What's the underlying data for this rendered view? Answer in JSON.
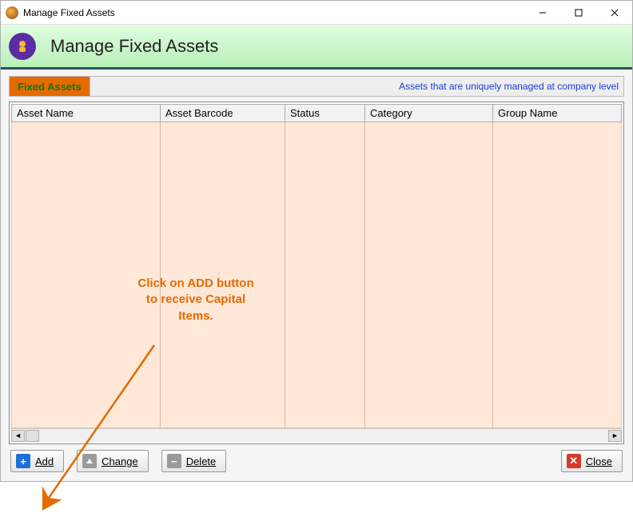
{
  "titlebar": {
    "title": "Manage Fixed Assets"
  },
  "header": {
    "title": "Manage Fixed Assets"
  },
  "tabs": {
    "active_label": "Fixed Assets",
    "hint": "Assets that are uniquely managed at company level"
  },
  "grid": {
    "columns": [
      {
        "label": "Asset Name",
        "width": 186
      },
      {
        "label": "Asset Barcode",
        "width": 156
      },
      {
        "label": "Status",
        "width": 100
      },
      {
        "label": "Category",
        "width": 160
      },
      {
        "label": "Group Name",
        "width": 150
      }
    ],
    "rows": []
  },
  "buttons": {
    "add": "Add",
    "change": "Change",
    "delete": "Delete",
    "close": "Close"
  },
  "annotation": {
    "text": "Click on ADD button to receive Capital Items."
  }
}
